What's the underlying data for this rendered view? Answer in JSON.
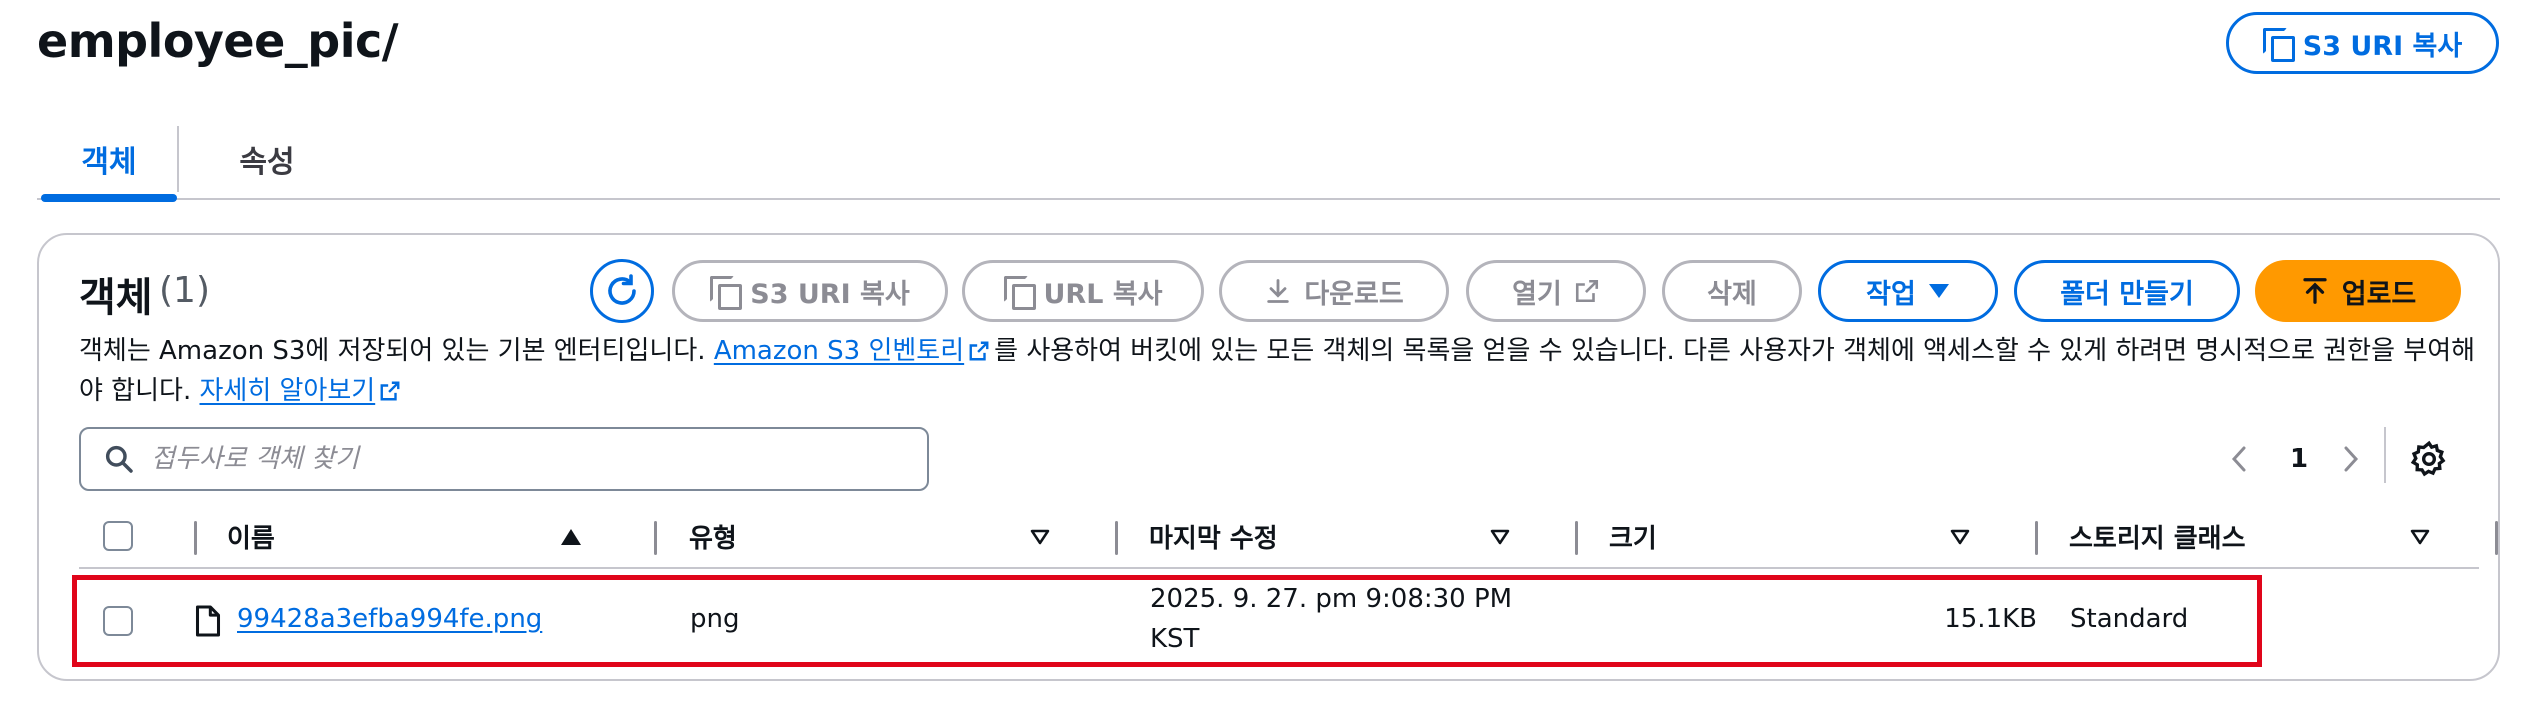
{
  "header": {
    "title": "employee_pic/",
    "copy_s3_uri_label": "S3 URI 복사"
  },
  "tabs": [
    {
      "label": "객체"
    },
    {
      "label": "속성"
    }
  ],
  "objects": {
    "title": "객체",
    "count": "(1)",
    "toolbar": {
      "copy_s3_uri": "S3 URI 복사",
      "copy_url": "URL 복사",
      "download": "다운로드",
      "open": "열기",
      "delete": "삭제",
      "actions": "작업",
      "create_folder": "폴더 만들기",
      "upload": "업로드"
    },
    "description": {
      "part1": "객체는 Amazon S3에 저장되어 있는 기본 엔터티입니다. ",
      "inventory_link": "Amazon S3 인벤토리",
      "part2": "를 사용하여 버킷에 있는 모든 객체의 목록을 얻을 수 있습니다. 다른 사용자가 객체에 액세스할 수 있게 하려면 명시적으로 권한을 부여해야 합니다. ",
      "learn_more_link": "자세히 알아보기"
    },
    "search": {
      "placeholder": "접두사로 객체 찾기",
      "value": ""
    },
    "pagination": {
      "current_page": "1"
    },
    "table": {
      "columns": [
        "이름",
        "유형",
        "마지막 수정",
        "크기",
        "스토리지 클래스"
      ],
      "rows": [
        {
          "name": "99428a3efba994fe.png",
          "type": "png",
          "last_modified_line1": "2025. 9. 27. pm 9:08:30 PM",
          "last_modified_line2": "KST",
          "size": "15.1KB",
          "storage_class": "Standard"
        }
      ]
    }
  },
  "colors": {
    "accent": "#006ce0",
    "upload_button": "#ff9900",
    "highlight_border": "#e0051a",
    "disabled": "#b4b4bb"
  },
  "icons": [
    "copy-icon",
    "refresh-icon",
    "download-icon",
    "external-link-icon",
    "caret-down-icon",
    "upload-icon",
    "search-icon",
    "chevron-left-icon",
    "chevron-right-icon",
    "gear-icon",
    "file-icon",
    "sort-ascending-icon",
    "sort-descending-icon"
  ]
}
